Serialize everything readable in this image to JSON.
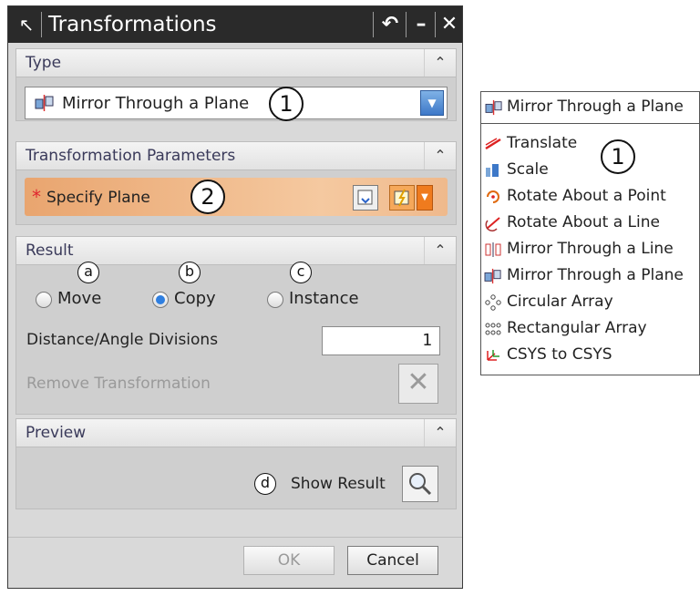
{
  "dialog": {
    "title": "Transformations",
    "sections": {
      "type": {
        "label": "Type",
        "selected": "Mirror Through a Plane",
        "callout": "1"
      },
      "params": {
        "label": "Transformation Parameters",
        "field": "Specify Plane",
        "required_mark": "*",
        "callout": "2"
      },
      "result": {
        "label": "Result",
        "options": [
          {
            "label": "Move",
            "callout": "a",
            "selected": false
          },
          {
            "label": "Copy",
            "callout": "b",
            "selected": true
          },
          {
            "label": "Instance",
            "callout": "c",
            "selected": false
          }
        ],
        "divisions_label": "Distance/Angle Divisions",
        "divisions_value": "1",
        "remove_label": "Remove Transformation"
      },
      "preview": {
        "label": "Preview",
        "show_result": "Show Result",
        "callout": "d"
      }
    },
    "buttons": {
      "ok": "OK",
      "cancel": "Cancel"
    },
    "colors": {
      "titlebar": "#2a2a2a",
      "accent": "#ef7b1e",
      "selected_radio": "#2f7fe0"
    }
  },
  "type_list": {
    "header": "Mirror Through a Plane",
    "callout": "1",
    "items": [
      {
        "label": "Translate",
        "icon": "translate-icon"
      },
      {
        "label": "Scale",
        "icon": "scale-icon"
      },
      {
        "label": "Rotate About a Point",
        "icon": "rotate-point-icon"
      },
      {
        "label": "Rotate About a Line",
        "icon": "rotate-line-icon"
      },
      {
        "label": "Mirror Through a Line",
        "icon": "mirror-line-icon"
      },
      {
        "label": "Mirror Through a Plane",
        "icon": "mirror-plane-icon"
      },
      {
        "label": "Circular Array",
        "icon": "circular-array-icon"
      },
      {
        "label": "Rectangular Array",
        "icon": "rectangular-array-icon"
      },
      {
        "label": "CSYS to CSYS",
        "icon": "csys-icon"
      }
    ]
  }
}
